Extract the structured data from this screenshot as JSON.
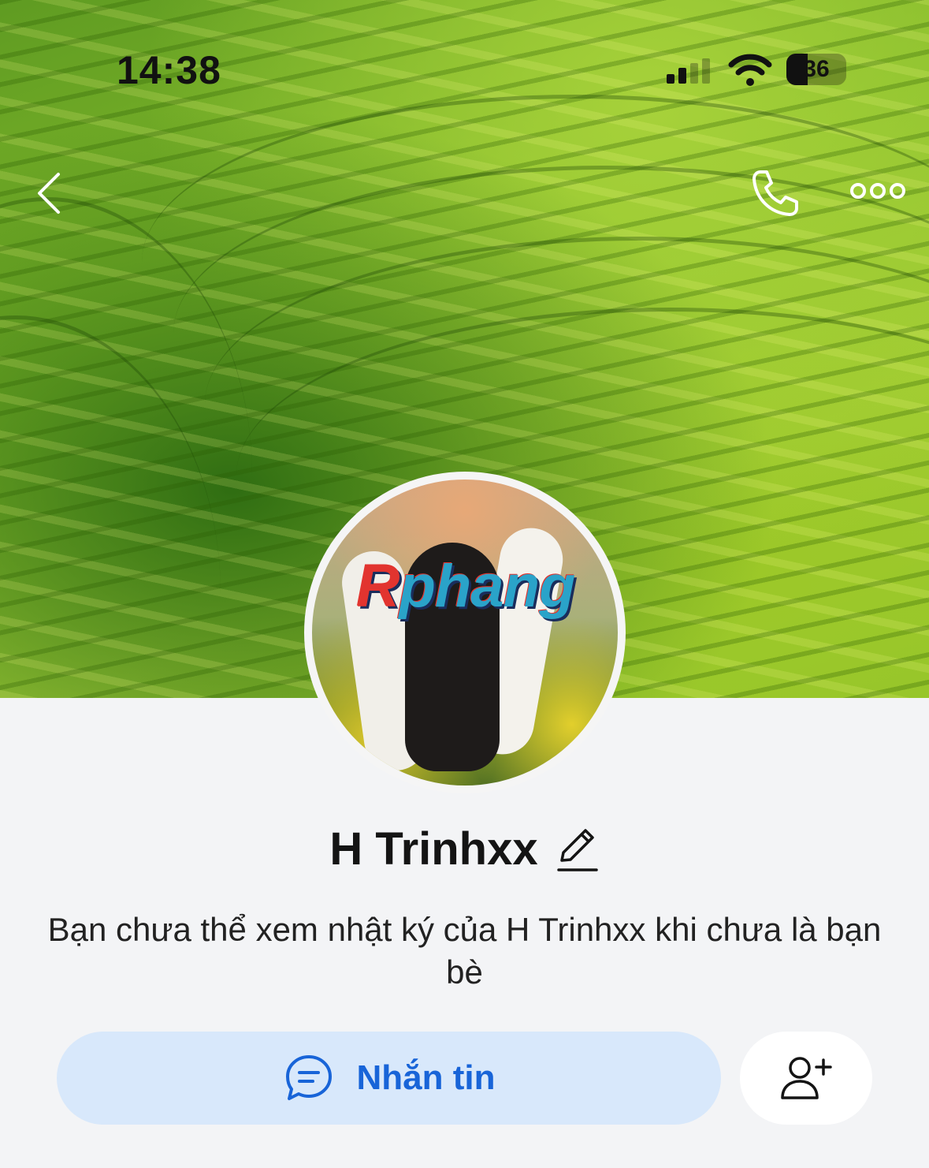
{
  "status_bar": {
    "time": "14:38",
    "battery_level": "36",
    "battery_fraction": 0.36
  },
  "header": {
    "back_icon": "chevron-left-icon",
    "call_icon": "phone-icon",
    "more_icon": "more-dots-icon"
  },
  "profile": {
    "watermark": "Rphang",
    "name": "H Trinhxx",
    "edit_icon": "pencil-icon",
    "privacy_note": "Bạn chưa thể xem nhật ký của H Trinhxx khi chưa là bạn bè"
  },
  "actions": {
    "message_label": "Nhắn tin",
    "message_icon": "chat-bubble-icon",
    "add_friend_icon": "add-friend-icon"
  },
  "colors": {
    "accent": "#1864d8",
    "message_button_bg": "#d8e8fb",
    "page_bg": "#f3f4f6"
  }
}
